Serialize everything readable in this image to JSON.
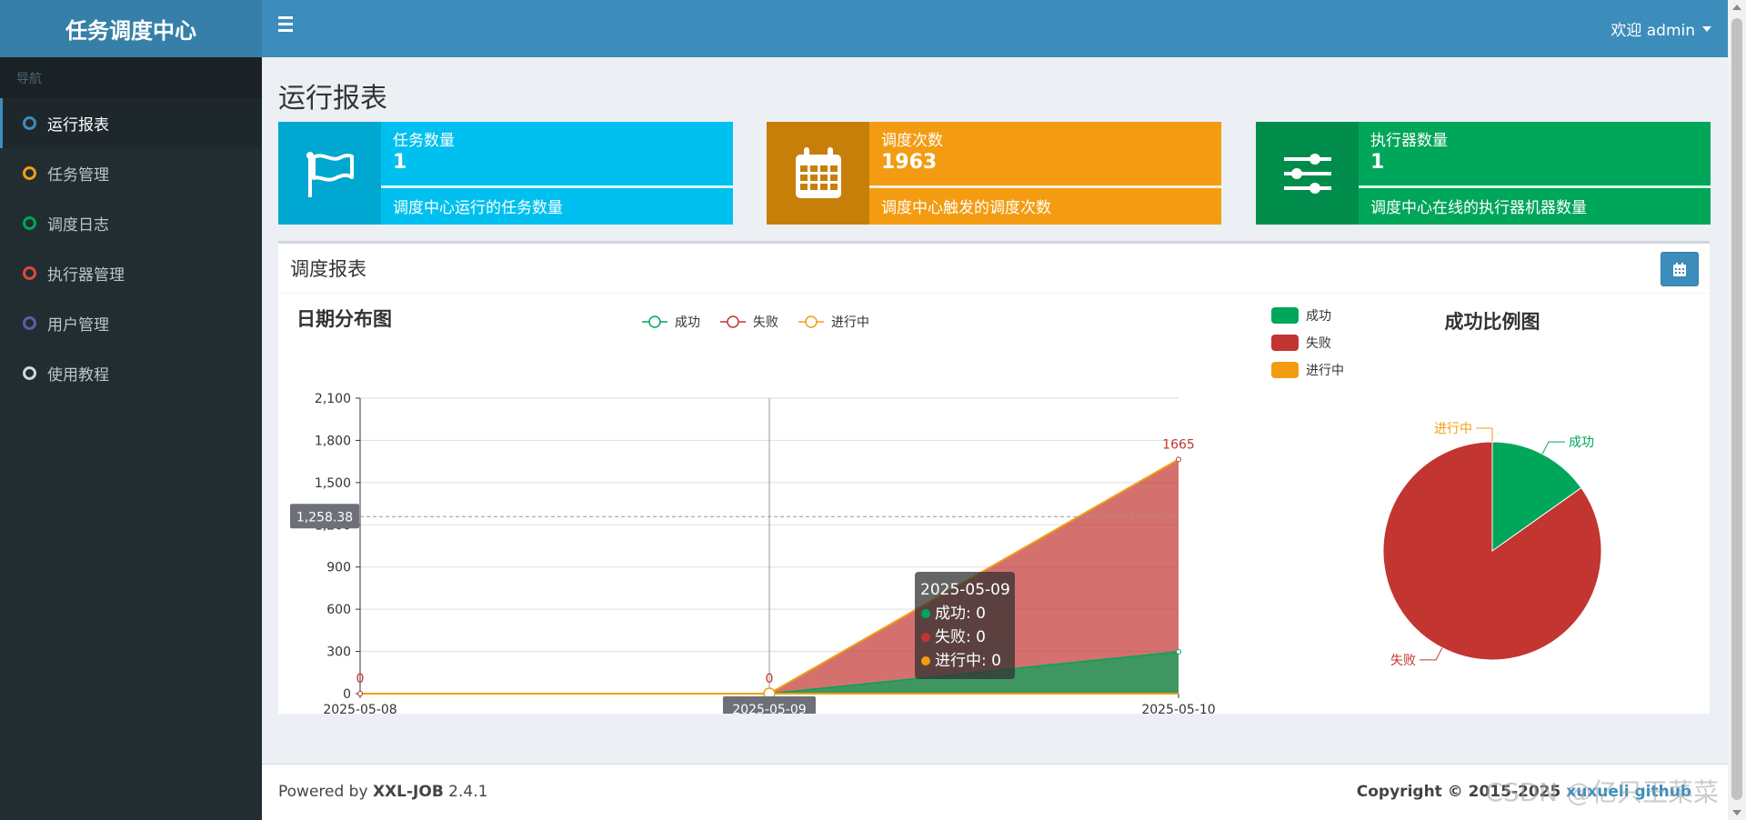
{
  "app": {
    "title": "任务调度中心"
  },
  "sidebar": {
    "header": "导航",
    "items": [
      {
        "label": "运行报表",
        "color": "#3c8dbc"
      },
      {
        "label": "任务管理",
        "color": "#f39c12"
      },
      {
        "label": "调度日志",
        "color": "#00a65a"
      },
      {
        "label": "执行器管理",
        "color": "#dd4b39"
      },
      {
        "label": "用户管理",
        "color": "#605ca8"
      },
      {
        "label": "使用教程",
        "color": "#d2d6de"
      }
    ]
  },
  "header": {
    "welcome": "欢迎 admin",
    "menu_icon": "hamburger-icon"
  },
  "page": {
    "title": "运行报表"
  },
  "stats": [
    {
      "label": "任务数量",
      "value": "1",
      "desc": "调度中心运行的任务数量",
      "icon": "flag-icon",
      "color": "#00c0ef",
      "icon_color": "#00a7d0"
    },
    {
      "label": "调度次数",
      "value": "1963",
      "desc": "调度中心触发的调度次数",
      "icon": "calendar-icon",
      "color": "#f39c12",
      "icon_color": "#c87f0a"
    },
    {
      "label": "执行器数量",
      "value": "1",
      "desc": "调度中心在线的执行器机器数量",
      "icon": "sliders-icon",
      "color": "#00a65a",
      "icon_color": "#008d4c"
    }
  ],
  "report": {
    "title": "调度报表",
    "calendar_icon": "calendar-icon"
  },
  "chart_data": [
    {
      "type": "area",
      "title": "日期分布图",
      "x": [
        "2025-05-08",
        "2025-05-09",
        "2025-05-10"
      ],
      "series": [
        {
          "name": "成功",
          "values": [
            0,
            0,
            298
          ],
          "color": "#00a65a"
        },
        {
          "name": "失败",
          "values": [
            0,
            0,
            1665
          ],
          "color": "#c23531"
        },
        {
          "name": "进行中",
          "values": [
            0,
            0,
            0
          ],
          "color": "#f39c12"
        }
      ],
      "ylim": [
        0,
        2100
      ],
      "yticks": [
        "0",
        "300",
        "600",
        "900",
        "1,200",
        "1,500",
        "1,800",
        "2,100"
      ],
      "point_labels": [
        "0",
        "0",
        "1665"
      ],
      "legend": "top",
      "axis_pointer": {
        "y_label": "1,258.38",
        "x_label": "2025-05-09"
      },
      "tooltip": {
        "date": "2025-05-09",
        "rows": [
          "成功: 0",
          "失败: 0",
          "进行中: 0"
        ]
      }
    },
    {
      "type": "pie",
      "title": "成功比例图",
      "categories": [
        "成功",
        "失败",
        "进行中"
      ],
      "values": [
        298,
        1665,
        0
      ],
      "colors": [
        "#00a65a",
        "#c23531",
        "#f39c12"
      ],
      "legend": "top-left"
    }
  ],
  "footer": {
    "powered": "Powered by ",
    "product": "XXL-JOB",
    "version": " 2.4.1",
    "copyright": "Copyright © 2015-2025 ",
    "author": "xuxueli",
    "github": "github"
  },
  "watermark": "CSDN @亿只王菜菜"
}
